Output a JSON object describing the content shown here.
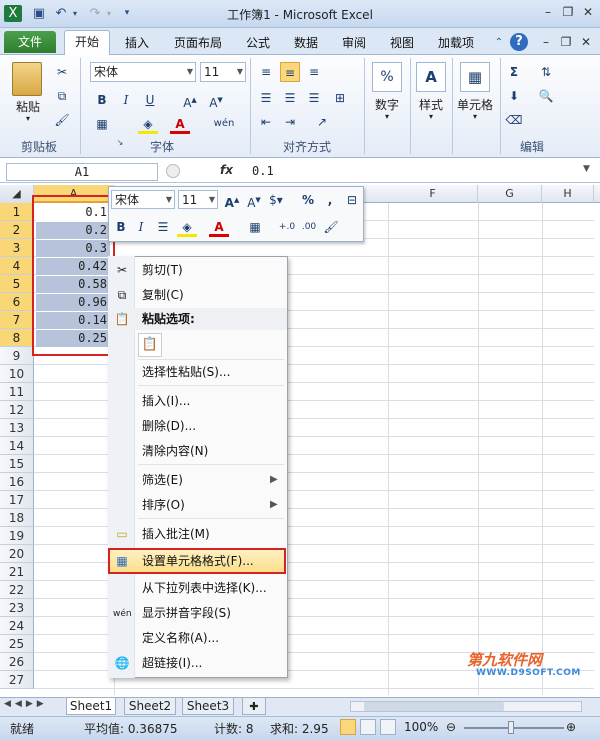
{
  "window": {
    "title": "工作簿1 - Microsoft Excel"
  },
  "tabs": [
    "文件",
    "开始",
    "插入",
    "页面布局",
    "公式",
    "数据",
    "审阅",
    "视图",
    "加载项"
  ],
  "ribbon": {
    "clipboard": {
      "label": "剪贴板",
      "paste": "粘贴"
    },
    "font": {
      "label": "字体",
      "name": "宋体",
      "size": "11"
    },
    "alignment": {
      "label": "对齐方式"
    },
    "number": {
      "label": "数字"
    },
    "styles": {
      "label": "样式"
    },
    "cells": {
      "label": "单元格"
    },
    "editing": {
      "label": "编辑",
      "sigma": "Σ"
    }
  },
  "formula": {
    "namebox": "A1",
    "fx": "fx",
    "value": "0.1"
  },
  "columns": [
    "A",
    "F",
    "G",
    "H"
  ],
  "rows": [
    "1",
    "2",
    "3",
    "4",
    "5",
    "6",
    "7",
    "8",
    "9",
    "10",
    "11",
    "12",
    "13",
    "14",
    "15",
    "16",
    "17",
    "18",
    "19",
    "20",
    "21",
    "22",
    "23",
    "24",
    "25",
    "26",
    "27"
  ],
  "cells_a": [
    "0.1",
    "0.2",
    "0.3",
    "0.42",
    "0.58",
    "0.96",
    "0.14",
    "0.25"
  ],
  "minitoolbar": {
    "font": "宋体",
    "size": "11",
    "percent": "%",
    "comma": ","
  },
  "context_menu": {
    "cut": "剪切(T)",
    "copy": "复制(C)",
    "paste_options": "粘贴选项:",
    "paste_special": "选择性粘贴(S)...",
    "insert": "插入(I)...",
    "delete": "删除(D)...",
    "clear": "清除内容(N)",
    "filter": "筛选(E)",
    "sort": "排序(O)",
    "insert_comment": "插入批注(M)",
    "format_cells": "设置单元格格式(F)...",
    "pick_list": "从下拉列表中选择(K)...",
    "phonetic": "显示拼音字段(S)",
    "define_name": "定义名称(A)...",
    "hyperlink": "超链接(I)..."
  },
  "sheets": [
    "Sheet1",
    "Sheet2",
    "Sheet3"
  ],
  "status": {
    "ready": "就绪",
    "average": "平均值: 0.36875",
    "count": "计数: 8",
    "sum": "求和: 2.95",
    "zoom": "100%"
  },
  "watermark": {
    "brand": "第九软件网",
    "url": "WWW.D9SOFT.COM"
  },
  "colors": {
    "accent_file": "#2f7d2f",
    "selection": "#b7c3da",
    "highlight": "#d8221f"
  }
}
